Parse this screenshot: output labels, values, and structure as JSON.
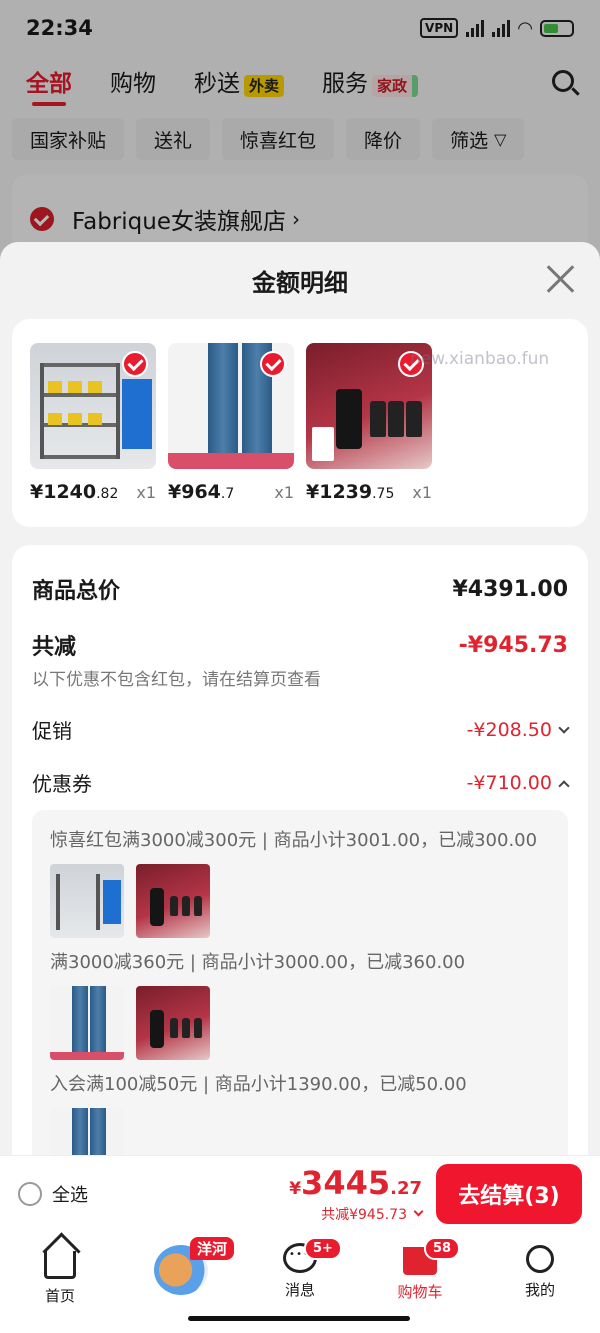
{
  "status_bar": {
    "time": "22:34",
    "vpn": "VPN"
  },
  "top_tabs": [
    {
      "label": "全部",
      "active": true
    },
    {
      "label": "购物"
    },
    {
      "label": "秒送",
      "tag": "外卖"
    },
    {
      "label": "服务",
      "tag": "家政"
    }
  ],
  "filters": [
    "国家补贴",
    "送礼",
    "惊喜红包",
    "降价",
    "筛选"
  ],
  "store": {
    "name": "Fabrique女装旗舰店",
    "arrow": "›"
  },
  "sheet": {
    "title": "金额明细",
    "watermark": "new.xianbao.fun",
    "products": [
      {
        "name": "shelf",
        "price_int": "¥1240",
        "price_dec": ".82",
        "qty": "x1"
      },
      {
        "name": "jeans",
        "price_int": "¥964",
        "price_dec": ".7",
        "qty": "x1"
      },
      {
        "name": "lancome",
        "price_int": "¥1239",
        "price_dec": ".75",
        "qty": "x1"
      }
    ],
    "summary": {
      "total_label": "商品总价",
      "total_value": "¥4391.00",
      "reduce_label": "共减",
      "reduce_value": "-¥945.73",
      "note": "以下优惠不包含红包，请在结算页查看",
      "promo_label": "促销",
      "promo_value": "-¥208.50",
      "coupon_label": "优惠券",
      "coupon_value": "-¥710.00"
    },
    "coupons": [
      {
        "text": "惊喜红包满3000减300元 | 商品小计3001.00，已减300.00",
        "thumbs": [
          "shelf",
          "lancome"
        ]
      },
      {
        "text": "满3000减360元 | 商品小计3000.00，已减360.00",
        "thumbs": [
          "jeans",
          "lancome"
        ]
      },
      {
        "text": "入会满100减50元 | 商品小计1390.00，已减50.00",
        "thumbs": [
          "jeans"
        ]
      }
    ]
  },
  "checkout": {
    "select_all": "全选",
    "yen": "¥",
    "total_int": "3445",
    "total_dec": ".27",
    "reduce_text": "共减¥945.73",
    "button": "去结算(3)"
  },
  "tabbar": {
    "home": "首页",
    "promo_tag": "洋河",
    "messages": "消息",
    "messages_badge": "5+",
    "cart": "购物车",
    "cart_badge": "58",
    "me": "我的"
  }
}
